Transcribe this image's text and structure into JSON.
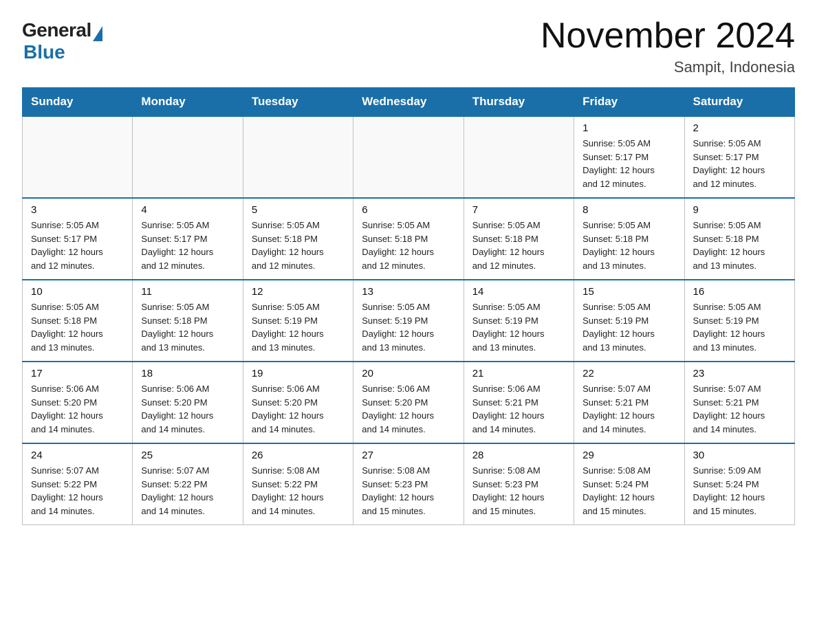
{
  "logo": {
    "general": "General",
    "blue": "Blue"
  },
  "title": "November 2024",
  "subtitle": "Sampit, Indonesia",
  "days_of_week": [
    "Sunday",
    "Monday",
    "Tuesday",
    "Wednesday",
    "Thursday",
    "Friday",
    "Saturday"
  ],
  "weeks": [
    [
      {
        "day": "",
        "info": ""
      },
      {
        "day": "",
        "info": ""
      },
      {
        "day": "",
        "info": ""
      },
      {
        "day": "",
        "info": ""
      },
      {
        "day": "",
        "info": ""
      },
      {
        "day": "1",
        "info": "Sunrise: 5:05 AM\nSunset: 5:17 PM\nDaylight: 12 hours\nand 12 minutes."
      },
      {
        "day": "2",
        "info": "Sunrise: 5:05 AM\nSunset: 5:17 PM\nDaylight: 12 hours\nand 12 minutes."
      }
    ],
    [
      {
        "day": "3",
        "info": "Sunrise: 5:05 AM\nSunset: 5:17 PM\nDaylight: 12 hours\nand 12 minutes."
      },
      {
        "day": "4",
        "info": "Sunrise: 5:05 AM\nSunset: 5:17 PM\nDaylight: 12 hours\nand 12 minutes."
      },
      {
        "day": "5",
        "info": "Sunrise: 5:05 AM\nSunset: 5:18 PM\nDaylight: 12 hours\nand 12 minutes."
      },
      {
        "day": "6",
        "info": "Sunrise: 5:05 AM\nSunset: 5:18 PM\nDaylight: 12 hours\nand 12 minutes."
      },
      {
        "day": "7",
        "info": "Sunrise: 5:05 AM\nSunset: 5:18 PM\nDaylight: 12 hours\nand 12 minutes."
      },
      {
        "day": "8",
        "info": "Sunrise: 5:05 AM\nSunset: 5:18 PM\nDaylight: 12 hours\nand 13 minutes."
      },
      {
        "day": "9",
        "info": "Sunrise: 5:05 AM\nSunset: 5:18 PM\nDaylight: 12 hours\nand 13 minutes."
      }
    ],
    [
      {
        "day": "10",
        "info": "Sunrise: 5:05 AM\nSunset: 5:18 PM\nDaylight: 12 hours\nand 13 minutes."
      },
      {
        "day": "11",
        "info": "Sunrise: 5:05 AM\nSunset: 5:18 PM\nDaylight: 12 hours\nand 13 minutes."
      },
      {
        "day": "12",
        "info": "Sunrise: 5:05 AM\nSunset: 5:19 PM\nDaylight: 12 hours\nand 13 minutes."
      },
      {
        "day": "13",
        "info": "Sunrise: 5:05 AM\nSunset: 5:19 PM\nDaylight: 12 hours\nand 13 minutes."
      },
      {
        "day": "14",
        "info": "Sunrise: 5:05 AM\nSunset: 5:19 PM\nDaylight: 12 hours\nand 13 minutes."
      },
      {
        "day": "15",
        "info": "Sunrise: 5:05 AM\nSunset: 5:19 PM\nDaylight: 12 hours\nand 13 minutes."
      },
      {
        "day": "16",
        "info": "Sunrise: 5:05 AM\nSunset: 5:19 PM\nDaylight: 12 hours\nand 13 minutes."
      }
    ],
    [
      {
        "day": "17",
        "info": "Sunrise: 5:06 AM\nSunset: 5:20 PM\nDaylight: 12 hours\nand 14 minutes."
      },
      {
        "day": "18",
        "info": "Sunrise: 5:06 AM\nSunset: 5:20 PM\nDaylight: 12 hours\nand 14 minutes."
      },
      {
        "day": "19",
        "info": "Sunrise: 5:06 AM\nSunset: 5:20 PM\nDaylight: 12 hours\nand 14 minutes."
      },
      {
        "day": "20",
        "info": "Sunrise: 5:06 AM\nSunset: 5:20 PM\nDaylight: 12 hours\nand 14 minutes."
      },
      {
        "day": "21",
        "info": "Sunrise: 5:06 AM\nSunset: 5:21 PM\nDaylight: 12 hours\nand 14 minutes."
      },
      {
        "day": "22",
        "info": "Sunrise: 5:07 AM\nSunset: 5:21 PM\nDaylight: 12 hours\nand 14 minutes."
      },
      {
        "day": "23",
        "info": "Sunrise: 5:07 AM\nSunset: 5:21 PM\nDaylight: 12 hours\nand 14 minutes."
      }
    ],
    [
      {
        "day": "24",
        "info": "Sunrise: 5:07 AM\nSunset: 5:22 PM\nDaylight: 12 hours\nand 14 minutes."
      },
      {
        "day": "25",
        "info": "Sunrise: 5:07 AM\nSunset: 5:22 PM\nDaylight: 12 hours\nand 14 minutes."
      },
      {
        "day": "26",
        "info": "Sunrise: 5:08 AM\nSunset: 5:22 PM\nDaylight: 12 hours\nand 14 minutes."
      },
      {
        "day": "27",
        "info": "Sunrise: 5:08 AM\nSunset: 5:23 PM\nDaylight: 12 hours\nand 15 minutes."
      },
      {
        "day": "28",
        "info": "Sunrise: 5:08 AM\nSunset: 5:23 PM\nDaylight: 12 hours\nand 15 minutes."
      },
      {
        "day": "29",
        "info": "Sunrise: 5:08 AM\nSunset: 5:24 PM\nDaylight: 12 hours\nand 15 minutes."
      },
      {
        "day": "30",
        "info": "Sunrise: 5:09 AM\nSunset: 5:24 PM\nDaylight: 12 hours\nand 15 minutes."
      }
    ]
  ],
  "colors": {
    "header_bg": "#1a6fa8",
    "header_text": "#ffffff",
    "border": "#c0c0c0"
  }
}
